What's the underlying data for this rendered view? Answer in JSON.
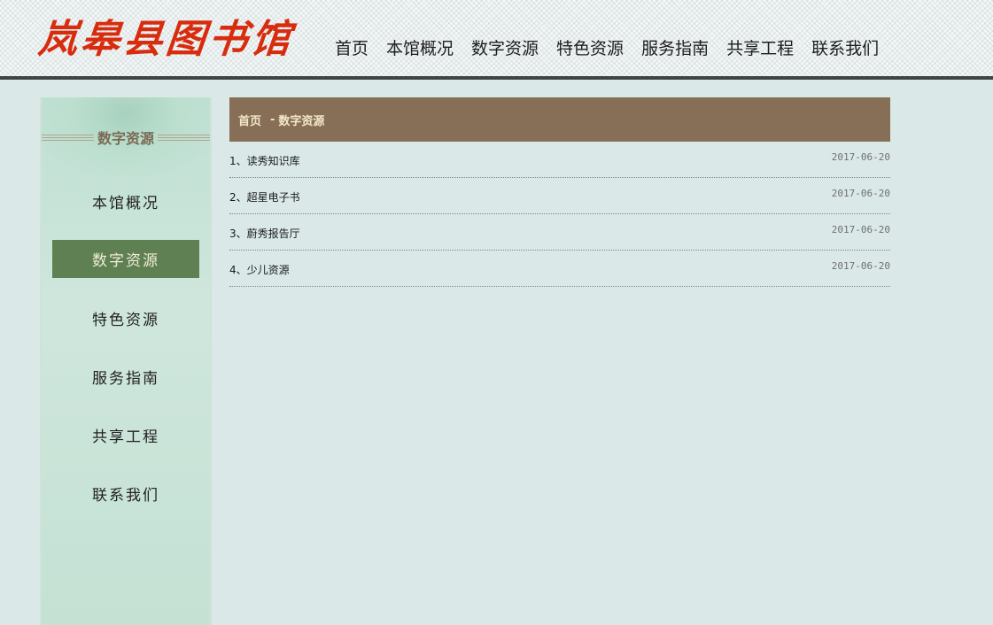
{
  "header": {
    "logo_text": "岚皋县图书馆",
    "nav": [
      "首页",
      "本馆概况",
      "数字资源",
      "特色资源",
      "服务指南",
      "共享工程",
      "联系我们"
    ]
  },
  "sidebar": {
    "title": "数字资源",
    "items": [
      {
        "label": "本馆概况",
        "active": false
      },
      {
        "label": "数字资源",
        "active": true
      },
      {
        "label": "特色资源",
        "active": false
      },
      {
        "label": "服务指南",
        "active": false
      },
      {
        "label": "共享工程",
        "active": false
      },
      {
        "label": "联系我们",
        "active": false
      }
    ]
  },
  "breadcrumb": {
    "home": "首页",
    "separator": "-",
    "current": "数字资源"
  },
  "articles": [
    {
      "title": "1、读秀知识库",
      "date": "2017-06-20"
    },
    {
      "title": "2、超星电子书",
      "date": "2017-06-20"
    },
    {
      "title": "3、蔚秀报告厅",
      "date": "2017-06-20"
    },
    {
      "title": "4、少儿资源",
      "date": "2017-06-20"
    }
  ],
  "colors": {
    "logo": "#d82c0e",
    "breadcrumb_bg": "#876e56",
    "sidebar_active_bg": "#5f8052",
    "page_bg": "#dae9e8"
  }
}
